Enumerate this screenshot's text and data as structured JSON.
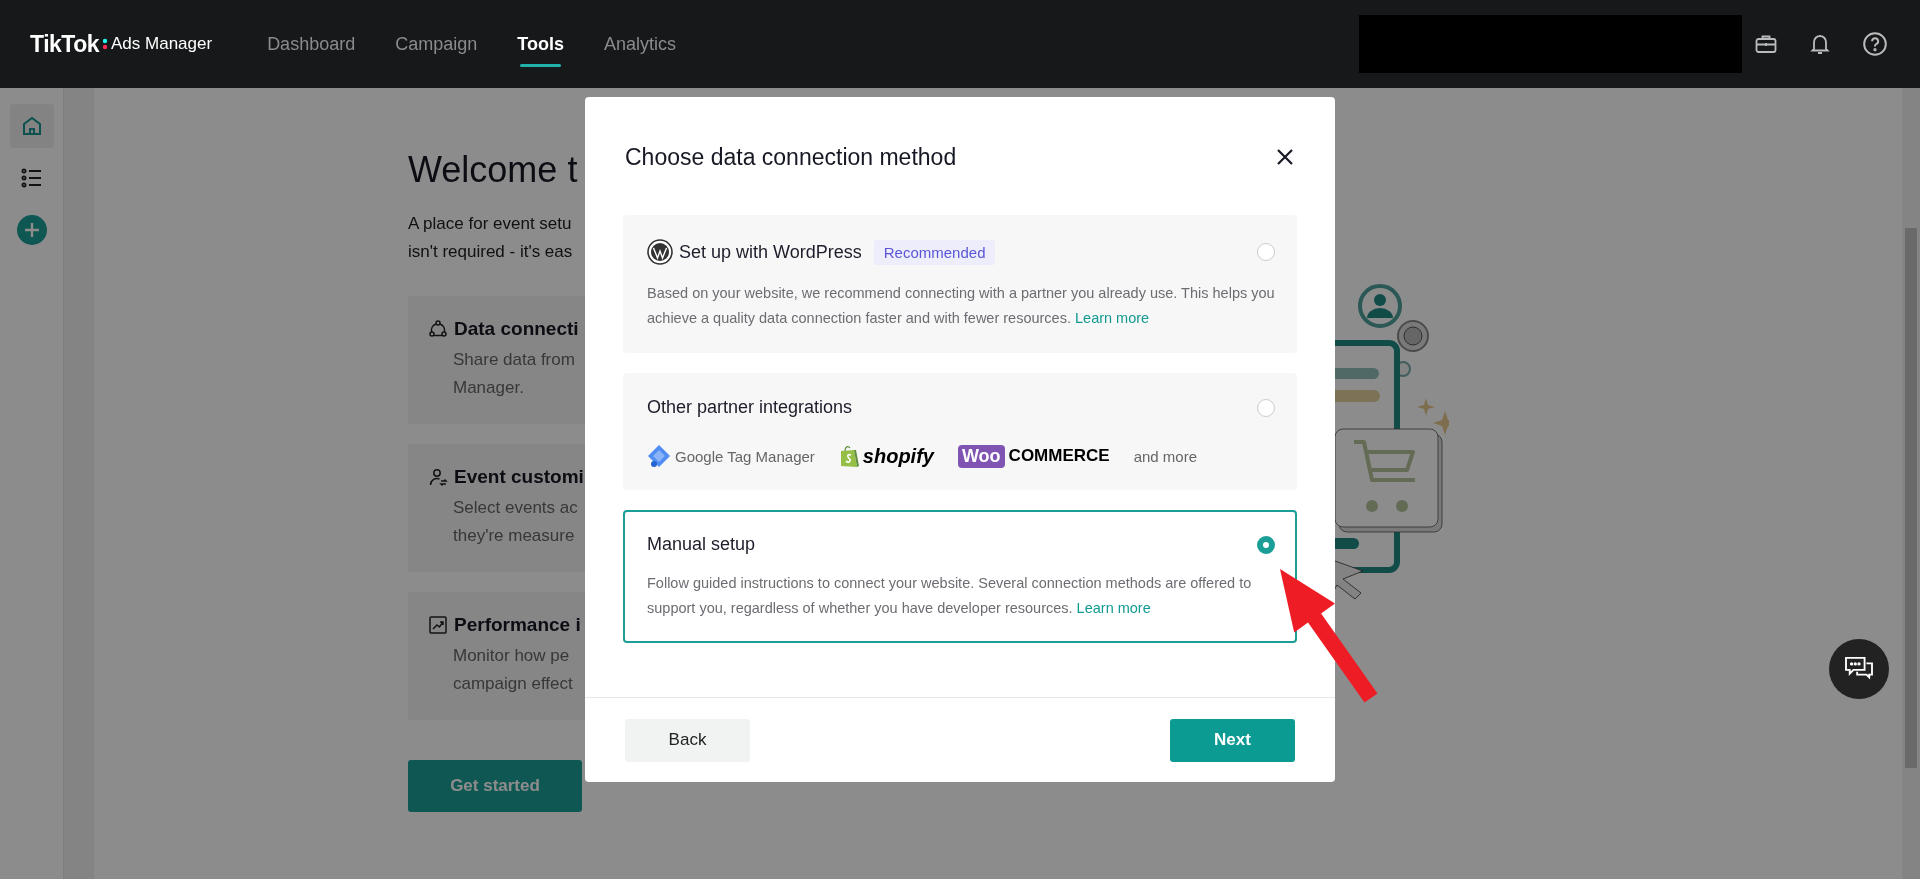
{
  "header": {
    "logo": {
      "brand": "TikTok",
      "product": "Ads Manager"
    },
    "nav": [
      {
        "label": "Dashboard",
        "selected": false
      },
      {
        "label": "Campaign",
        "selected": false
      },
      {
        "label": "Tools",
        "selected": true
      },
      {
        "label": "Analytics",
        "selected": false
      }
    ],
    "actions": [
      {
        "kind": "briefcase"
      },
      {
        "kind": "bell"
      },
      {
        "kind": "help"
      }
    ]
  },
  "sidebar": {
    "items": [
      {
        "kind": "home",
        "selected": true
      },
      {
        "kind": "list",
        "selected": false
      },
      {
        "kind": "add",
        "selected": false
      }
    ]
  },
  "page": {
    "title": "Welcome t",
    "intro": [
      "A place for event setu",
      "isn't required - it's eas"
    ],
    "features": [
      {
        "kind": "connect",
        "title": "Data connecti",
        "lines": [
          "Share data from",
          "Manager."
        ]
      },
      {
        "kind": "person",
        "title": "Event customi",
        "lines": [
          "Select events ac",
          "they're measure"
        ]
      },
      {
        "kind": "chart",
        "title": "Performance i",
        "lines": [
          "Monitor how pe",
          "campaign effect"
        ]
      }
    ],
    "cta": "Get started"
  },
  "dialog": {
    "title": "Choose data connection method",
    "options": [
      {
        "kind": "wordpress",
        "title": "Set up with WordPress",
        "badge": "Recommended",
        "description": "Based on your website, we recommend connecting with a partner you already use. This helps you achieve a quality data connection faster and with fewer resources.",
        "link": "Learn more",
        "selected": false
      },
      {
        "kind": "partners",
        "title": "Other partner integrations",
        "partners": [
          {
            "kind": "gtm",
            "name": "Google Tag Manager"
          },
          {
            "kind": "shopify",
            "name": "shopify"
          },
          {
            "kind": "woo",
            "name": "Woo",
            "suffix": "COMMERCE"
          }
        ],
        "more": "and more",
        "selected": false
      },
      {
        "kind": "manual",
        "title": "Manual setup",
        "description": "Follow guided instructions to connect your website. Several connection methods are offered to support you, regardless of whether you have developer resources.",
        "link": "Learn more",
        "selected": true
      }
    ],
    "buttons": {
      "back": "Back",
      "next": "Next"
    }
  }
}
